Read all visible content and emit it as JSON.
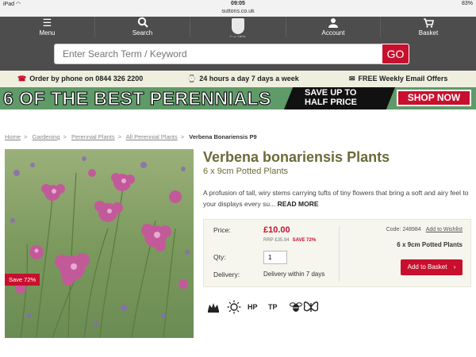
{
  "status": {
    "device": "iPad",
    "wifi_icon": "wifi-icon",
    "time": "09:05",
    "battery": "83%"
  },
  "url": "suttons.co.uk",
  "nav": {
    "items": [
      {
        "label": "Menu",
        "icon": "hamburger-icon"
      },
      {
        "label": "Search",
        "icon": "search-icon"
      },
      {
        "label": "Account",
        "icon": "account-icon"
      },
      {
        "label": "Basket",
        "icon": "basket-icon"
      }
    ],
    "logo_est": "Est 1806"
  },
  "search": {
    "placeholder": "Enter Search Term / Keyword",
    "button": "GO"
  },
  "infobar": {
    "phone": "Order by phone on 0844 326 2200",
    "hours": "24 hours a day 7 days a week",
    "email": "FREE Weekly Email Offers"
  },
  "banner": {
    "headline": "6 OF THE BEST PERENNIALS",
    "save_line1": "SAVE UP TO",
    "save_line2": "HALF PRICE",
    "shop": "SHOP NOW"
  },
  "breadcrumb": {
    "items": [
      "Home",
      "Gardening",
      "Perennial Plants",
      "All Perennial Plants"
    ],
    "current": "Verbena Bonariensis P9",
    "sep": ">"
  },
  "product": {
    "title": "Verbena bonariensis Plants",
    "subtitle": "6 x 9cm Potted Plants",
    "description": "A profusion of tall, wiry stems carrying tufts of tiny flowers that bring a soft and airy feel to your displays every su...",
    "read_more": "READ MORE",
    "save_badge": "Save 72%"
  },
  "buybox": {
    "price_label": "Price:",
    "price": "£10.00",
    "rrp": "RRP £35.94",
    "save_pct": "SAVE 72%",
    "qty_label": "Qty:",
    "qty": "1",
    "delivery_label": "Delivery:",
    "delivery": "Delivery within 7 days",
    "code": "Code: 248984",
    "wishlist": "Add to Wishlist",
    "pack": "6 x 9cm Potted Plants",
    "add_basket": "Add to Basket",
    "basket_arrow": "›"
  },
  "badges": {
    "hp": "HP",
    "tp": "TP"
  },
  "colors": {
    "brand_red": "#c8102e",
    "nav_grey": "#4d4d4d",
    "title_olive": "#6b6b38",
    "banner_green": "#5f9a69"
  }
}
